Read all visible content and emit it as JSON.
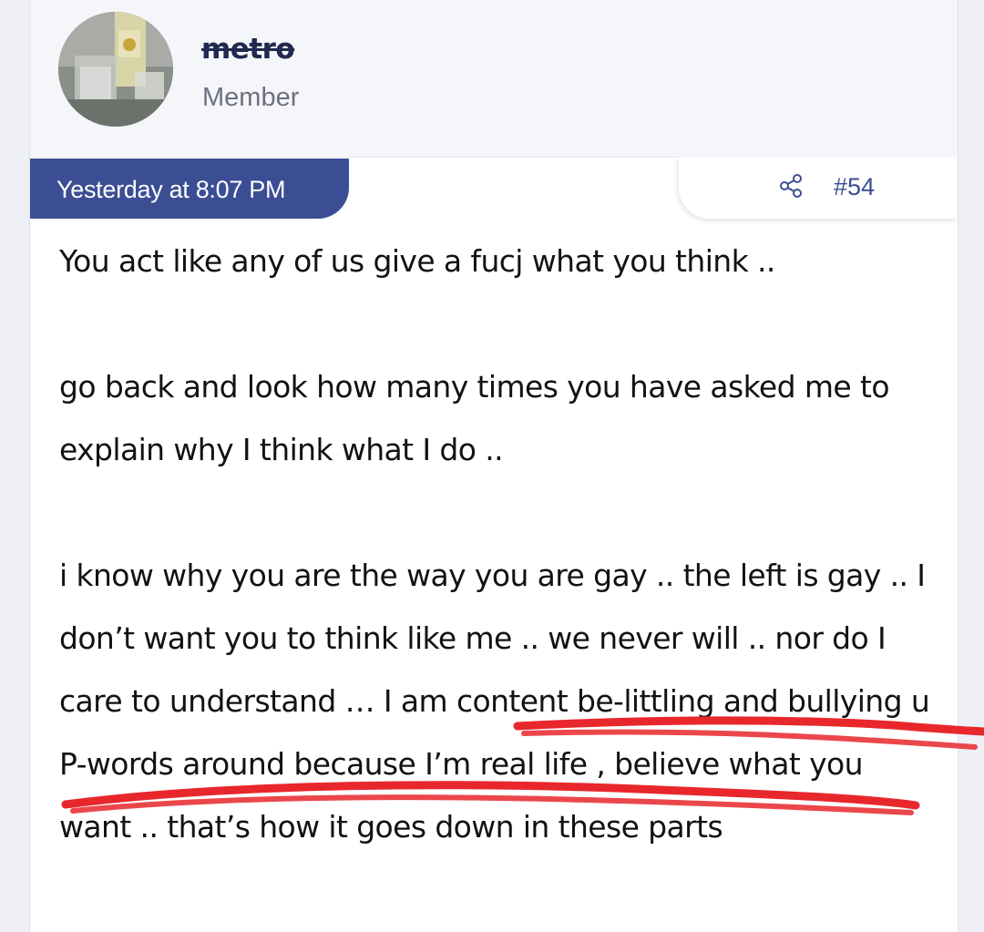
{
  "user": {
    "name": "metro",
    "title": "Member"
  },
  "post": {
    "timestamp": "Yesterday at 8:07 PM",
    "number": "#54",
    "paragraphs": [
      "You act like any of us give a fucj what you think ..",
      "go back and look how many times you have asked me to explain why I think what I do ..",
      "i know why you are the way you are gay .. the left is gay .. I don’t want you to think like me .. we never will .. nor do I care to understand … I am content be-littling and bullying u P-words around because I’m real life , believe what you want .. that’s how it goes down in these parts"
    ]
  },
  "icons": {
    "share": "share-icon"
  },
  "colors": {
    "accent": "#3c4e93",
    "username": "#20294f",
    "annotation": "#e8272c"
  }
}
